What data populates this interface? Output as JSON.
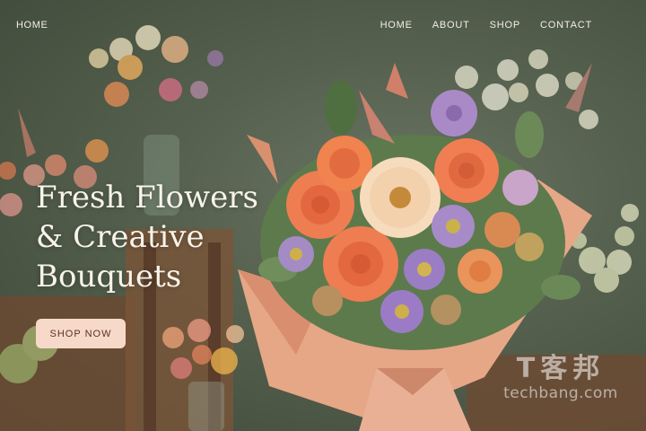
{
  "logo": {
    "label": "HOME"
  },
  "nav": {
    "items": [
      {
        "label": "HOME"
      },
      {
        "label": "ABOUT"
      },
      {
        "label": "SHOP"
      },
      {
        "label": "CONTACT"
      }
    ]
  },
  "hero": {
    "headline_lines": [
      "Fresh Flowers",
      "& Creative",
      "Bouquets"
    ],
    "cta_label": "SHOP NOW"
  },
  "watermark": {
    "cjk": "T客邦",
    "latin": "techbang.com"
  },
  "colors": {
    "background": "#4f5a48",
    "headline_text": "#f7f3ea",
    "cta_background": "#f6d9c9",
    "cta_text": "#5b3324",
    "rose": "#ef7d52",
    "wrap_paper": "#e6a787"
  }
}
